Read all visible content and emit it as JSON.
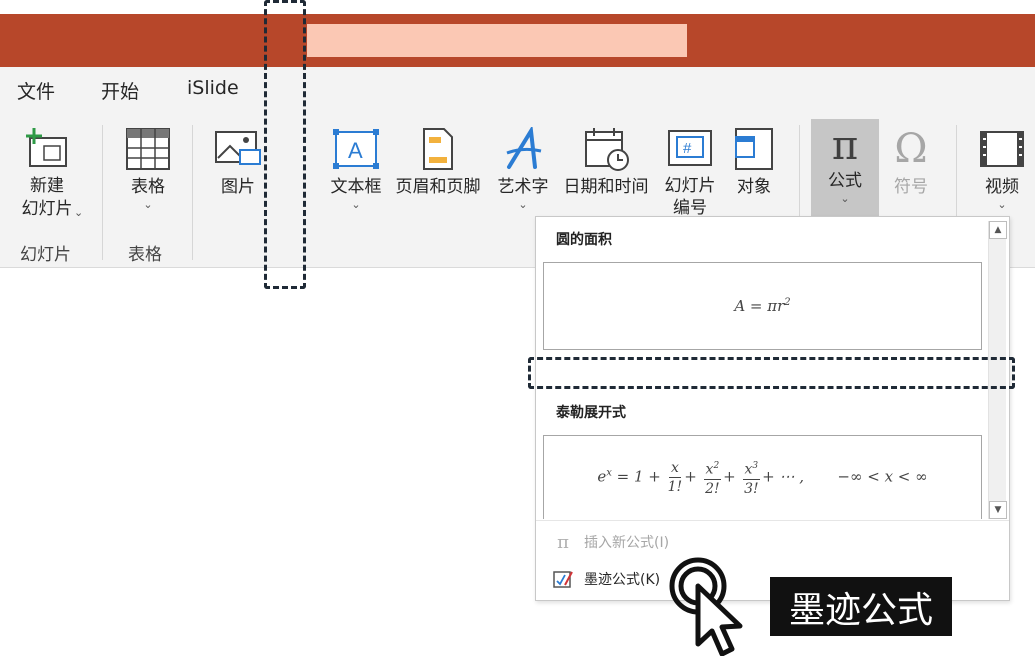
{
  "tabs": [
    "文件",
    "开始",
    "iSlide"
  ],
  "ribbon": {
    "new_slide": "新建\n幻灯片",
    "table": "表格",
    "picture": "图片",
    "textbox": "文本框",
    "header_footer": "页眉和页脚",
    "wordart": "艺术字",
    "datetime": "日期和时间",
    "slide_number": "幻灯片\n编号",
    "object": "对象",
    "formula": "公式",
    "symbol": "符号",
    "video": "视频"
  },
  "groups": {
    "slides": "幻灯片",
    "tables": "表格"
  },
  "dropdown": {
    "section1_title": "圆的面积",
    "section2_title": "泰勒展开式",
    "insert_new": "插入新公式(I)",
    "ink_equation": "墨迹公式(K)"
  },
  "callout": "墨迹公式",
  "colors": {
    "title_bar": "#b7472a",
    "accent_blue": "#2b7cd3"
  }
}
